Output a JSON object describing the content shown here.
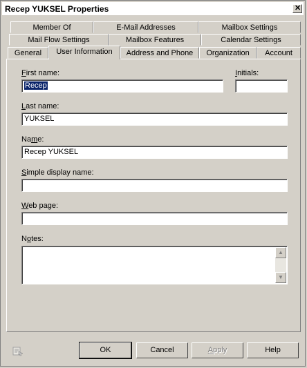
{
  "window": {
    "title": "Recep YUKSEL Properties",
    "close_glyph": "✕"
  },
  "tabs": {
    "row1": [
      "Member Of",
      "E-Mail Addresses",
      "Mailbox Settings"
    ],
    "row2": [
      "Mail Flow Settings",
      "Mailbox Features",
      "Calendar Settings"
    ],
    "row3": [
      "General",
      "User Information",
      "Address and Phone",
      "Organization",
      "Account"
    ],
    "active": "User Information"
  },
  "form": {
    "first_name": {
      "label_ul": "F",
      "label_rest": "irst name:",
      "value": "Recep"
    },
    "initials": {
      "label_ul": "I",
      "label_rest": "nitials:",
      "value": ""
    },
    "last_name": {
      "label_ul": "L",
      "label_rest": "ast name:",
      "value": "YUKSEL"
    },
    "name": {
      "label_pre": "Na",
      "label_ul": "m",
      "label_rest": "e:",
      "value": "Recep YUKSEL"
    },
    "simple_display_name": {
      "label_ul": "S",
      "label_rest": "imple display name:",
      "value": ""
    },
    "web_page": {
      "label_ul": "W",
      "label_rest": "eb page:",
      "value": ""
    },
    "notes": {
      "label_pre": "N",
      "label_ul": "o",
      "label_rest": "tes:",
      "value": ""
    }
  },
  "buttons": {
    "ok": "OK",
    "cancel": "Cancel",
    "apply_ul": "A",
    "apply_rest": "pply",
    "help": "Help",
    "apply_disabled": true
  },
  "colors": {
    "selection": "#0a246a",
    "face": "#d4d0c8"
  }
}
